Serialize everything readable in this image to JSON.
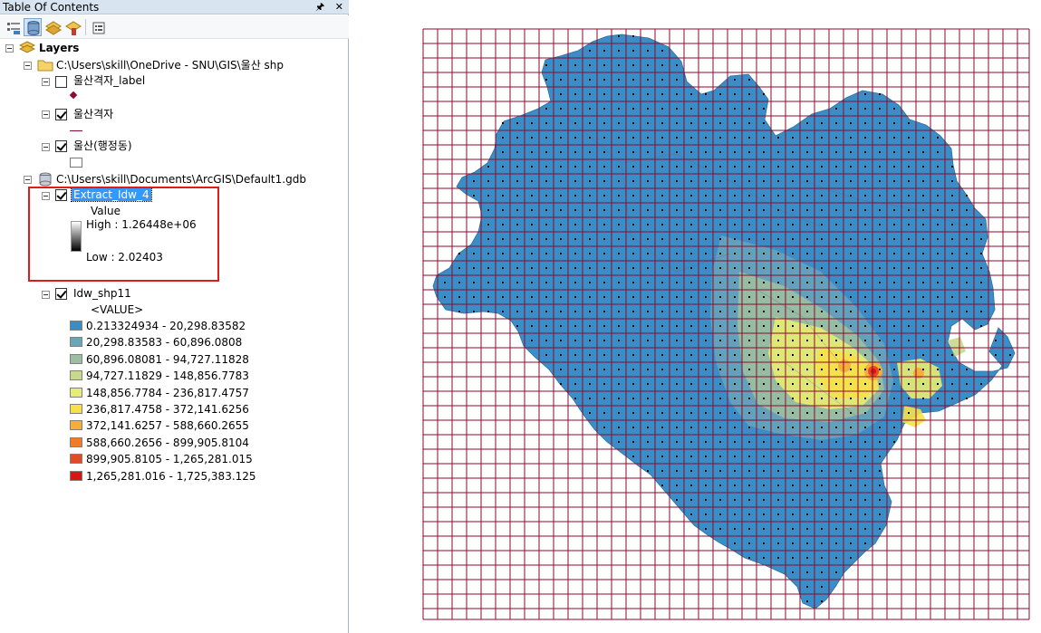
{
  "toc": {
    "title": "Table Of Contents",
    "pin_icon": "pin-icon",
    "close_icon": "close-icon",
    "toolbar": [
      "list-by-drawing-order-icon",
      "list-by-source-icon",
      "list-by-visibility-icon",
      "list-by-selection-icon",
      "options-icon"
    ],
    "layers_root": "Layers",
    "folder1": "C:\\Users\\skill\\OneDrive - SNU\\GIS\\울산 shp",
    "layer_label": "울산격자_label",
    "layer_grid": "울산격자",
    "layer_admin": "울산(행정동)",
    "gdb": "C:\\Users\\skill\\Documents\\ArcGIS\\Default1.gdb",
    "extract": {
      "name": "Extract_Idw_4",
      "value_title": "Value",
      "high": "High : 1.26448e+06",
      "low": "Low : 2.02403"
    },
    "idw": {
      "name": "Idw_shp11",
      "field": "<VALUE>",
      "classes": [
        {
          "label": "0.213324934 - 20,298.83582",
          "color": "#3a8ec8"
        },
        {
          "label": "20,298.83583 - 60,896.0808",
          "color": "#6aa5b8"
        },
        {
          "label": "60,896.08081 - 94,727.11828",
          "color": "#9cbfa2"
        },
        {
          "label": "94,727.11829 - 148,856.7783",
          "color": "#c9d98a"
        },
        {
          "label": "148,856.7784 - 236,817.4757",
          "color": "#e7ec72"
        },
        {
          "label": "236,817.4758 - 372,141.6256",
          "color": "#f7e048"
        },
        {
          "label": "372,141.6257 - 588,660.2655",
          "color": "#f5ae3c"
        },
        {
          "label": "588,660.2656 - 899,905.8104",
          "color": "#ee7c2a"
        },
        {
          "label": "899,905.8105 - 1,265,281.015",
          "color": "#e44b22"
        },
        {
          "label": "1,265,281.016 - 1,725,383.125",
          "color": "#d91414"
        }
      ]
    }
  },
  "colors": {
    "grid": "#8b0a2e",
    "base": "#3a8ec8",
    "highlight": "#e01b1b"
  }
}
